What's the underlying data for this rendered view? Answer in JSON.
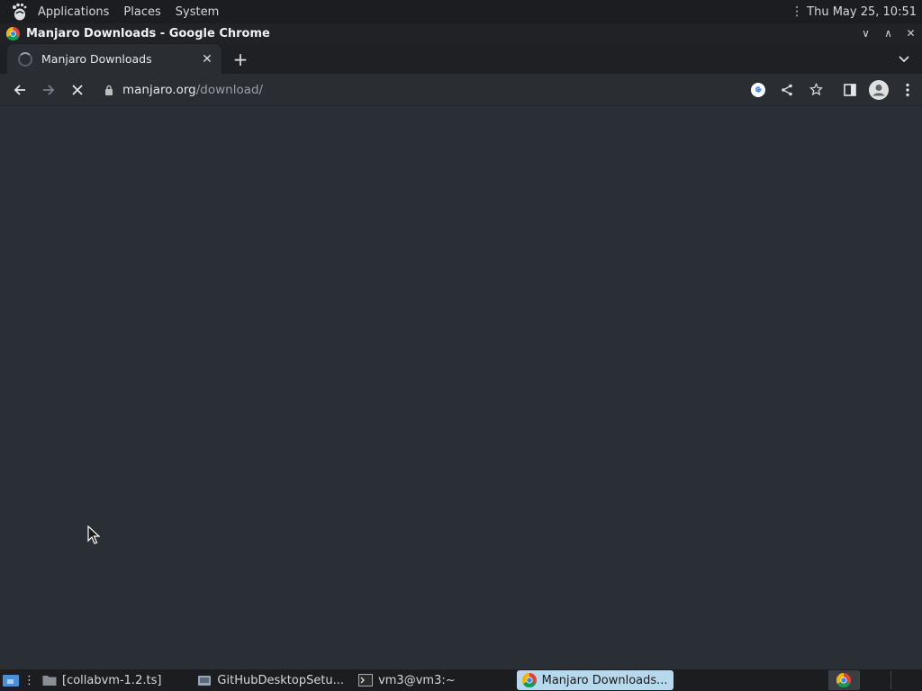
{
  "top_panel": {
    "menus": [
      "Applications",
      "Places",
      "System"
    ],
    "clock": "Thu May 25, 10:51"
  },
  "window": {
    "title": "Manjaro Downloads - Google Chrome"
  },
  "browser": {
    "tab": {
      "title": "Manjaro Downloads"
    },
    "address": {
      "host": "manjaro.org",
      "path": "/download/"
    }
  },
  "taskbar": {
    "items": [
      {
        "label": "[collabvm-1.2.ts]",
        "icon": "folder-icon"
      },
      {
        "label": "GitHubDesktopSetu...",
        "icon": "installer-icon"
      },
      {
        "label": "vm3@vm3:~",
        "icon": "terminal-icon"
      },
      {
        "label": "Manjaro Downloads...",
        "icon": "chrome-icon",
        "active": true
      }
    ]
  },
  "colors": {
    "content_bg": "#2a2f36",
    "active_task": "#b6d9ee"
  }
}
